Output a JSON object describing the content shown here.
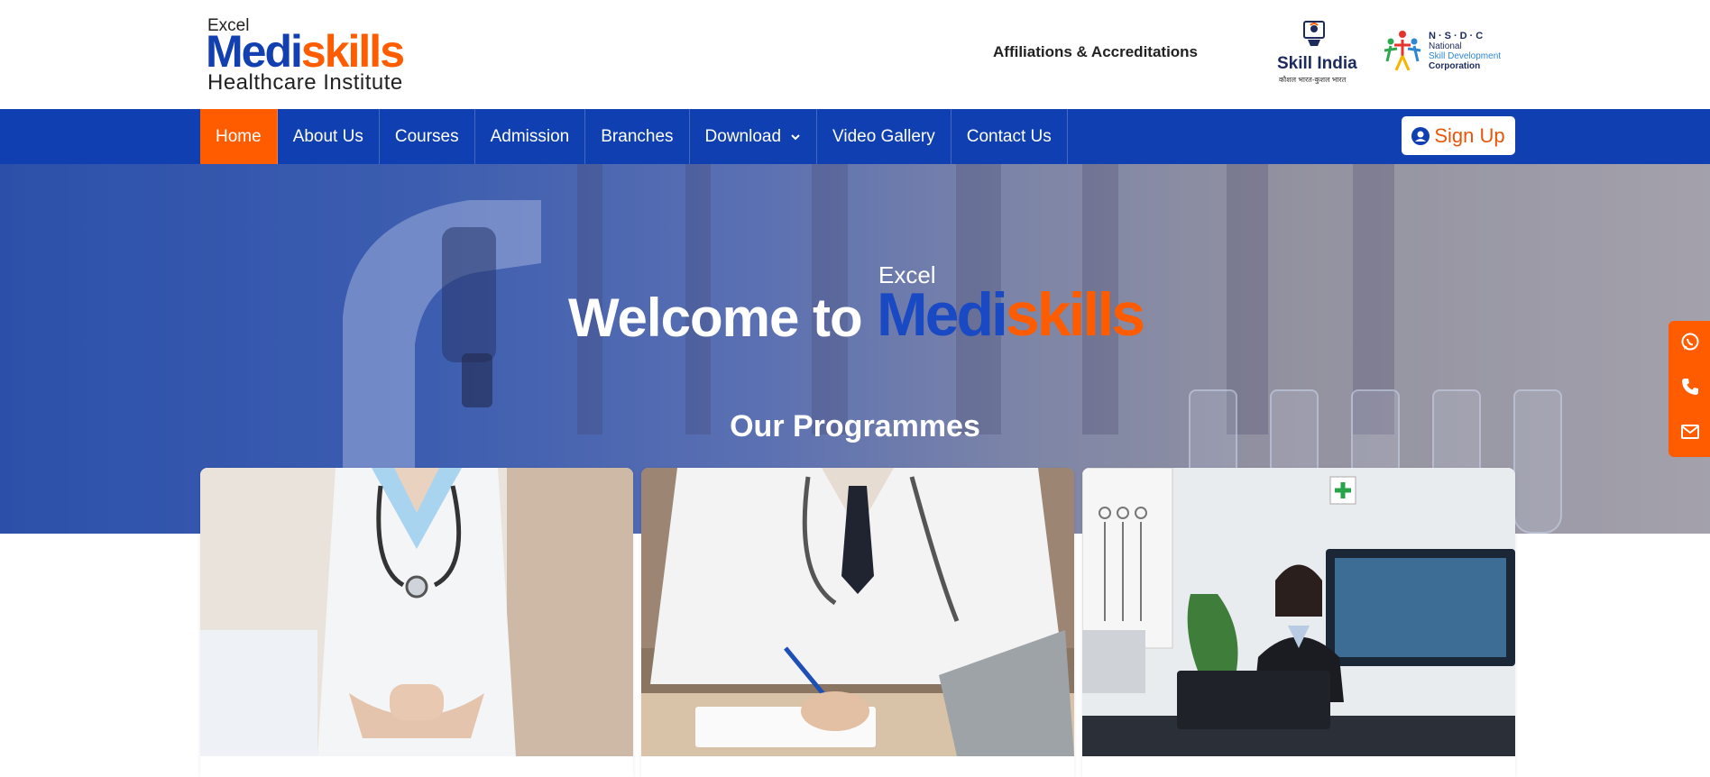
{
  "header": {
    "logo": {
      "excel": "Excel",
      "medi": "Medi",
      "skills": "skills",
      "sub": "Healthcare Institute"
    },
    "affiliations_label": "Affiliations & Accreditations",
    "skill_india": {
      "brand": "Skill India",
      "hindi": "कौशल भारत-कुशल भारत"
    },
    "nsdc": {
      "l1": "N·S·D·C",
      "l2": "National",
      "l3": "Skill Development",
      "l4": "Corporation"
    }
  },
  "nav": {
    "items": [
      {
        "label": "Home",
        "active": true
      },
      {
        "label": "About Us"
      },
      {
        "label": "Courses"
      },
      {
        "label": "Admission"
      },
      {
        "label": "Branches"
      },
      {
        "label": "Download",
        "dropdown": true
      },
      {
        "label": "Video Gallery"
      },
      {
        "label": "Contact Us"
      }
    ],
    "signup_label": "Sign Up"
  },
  "hero": {
    "welcome": "Welcome to",
    "excel": "Excel",
    "medi": "Medi",
    "skills": "skills",
    "programmes_title": "Our Programmes"
  },
  "cards": [
    {
      "image": "nurse-in-uniform-photo"
    },
    {
      "image": "doctor-writing-at-desk-photo"
    },
    {
      "image": "receptionist-at-clinic-desk-photo"
    }
  ],
  "floating_contact": {
    "icons": [
      "whatsapp-icon",
      "phone-icon",
      "mail-icon"
    ]
  },
  "colors": {
    "brand_blue": "#0f3fb0",
    "brand_orange": "#ff5c00"
  }
}
